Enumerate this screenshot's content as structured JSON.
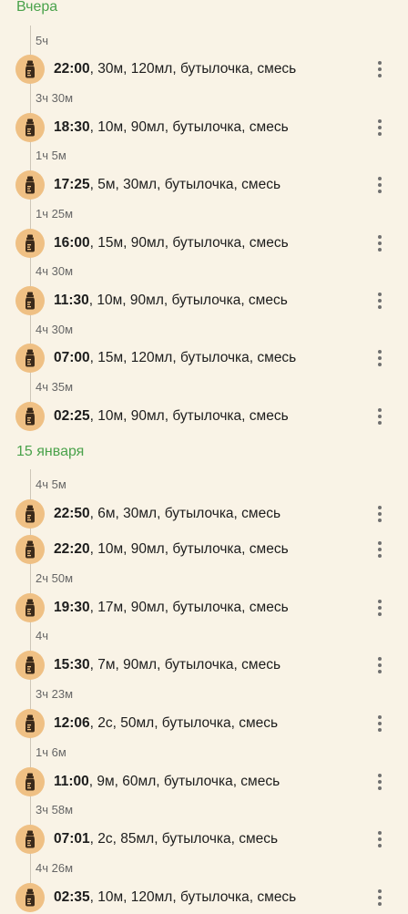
{
  "sections": [
    {
      "header": "Вчера",
      "items": [
        {
          "gap": "5ч",
          "time": "22:00",
          "details": ", 30м, 120мл, бутылочка, смесь"
        },
        {
          "gap": "3ч 30м",
          "time": "18:30",
          "details": ", 10м, 90мл, бутылочка, смесь"
        },
        {
          "gap": "1ч 5м",
          "time": "17:25",
          "details": ", 5м, 30мл, бутылочка, смесь"
        },
        {
          "gap": "1ч 25м",
          "time": "16:00",
          "details": ", 15м, 90мл, бутылочка, смесь"
        },
        {
          "gap": "4ч 30м",
          "time": "11:30",
          "details": ", 10м, 90мл, бутылочка, смесь"
        },
        {
          "gap": "4ч 30м",
          "time": "07:00",
          "details": ", 15м, 120мл, бутылочка, смесь"
        },
        {
          "gap": "4ч 35м",
          "time": "02:25",
          "details": ", 10м, 90мл, бутылочка, смесь"
        }
      ]
    },
    {
      "header": "15 января",
      "items": [
        {
          "gap": "4ч 5м",
          "time": "22:50",
          "details": ", 6м, 30мл, бутылочка, смесь"
        },
        {
          "gap": "",
          "time": "22:20",
          "details": ", 10м, 90мл, бутылочка, смесь"
        },
        {
          "gap": "2ч 50м",
          "time": "19:30",
          "details": ", 17м, 90мл, бутылочка, смесь"
        },
        {
          "gap": "4ч",
          "time": "15:30",
          "details": ", 7м, 90мл, бутылочка, смесь"
        },
        {
          "gap": "3ч 23м",
          "time": "12:06",
          "details": ", 2с, 50мл, бутылочка, смесь"
        },
        {
          "gap": "1ч 6м",
          "time": "11:00",
          "details": ", 9м, 60мл, бутылочка, смесь"
        },
        {
          "gap": "3ч 58м",
          "time": "07:01",
          "details": ", 2с, 85мл, бутылочка, смесь"
        },
        {
          "gap": "4ч 26м",
          "time": "02:35",
          "details": ", 10м, 120мл, бутылочка, смесь"
        }
      ]
    }
  ],
  "icons": {
    "entry": "baby-bottle-icon",
    "menu": "more-vertical-icon"
  },
  "colors": {
    "background": "#f9f3e6",
    "header": "#4aa24b",
    "icon_bg": "#efc084",
    "icon_fg": "#3b2a1a"
  }
}
